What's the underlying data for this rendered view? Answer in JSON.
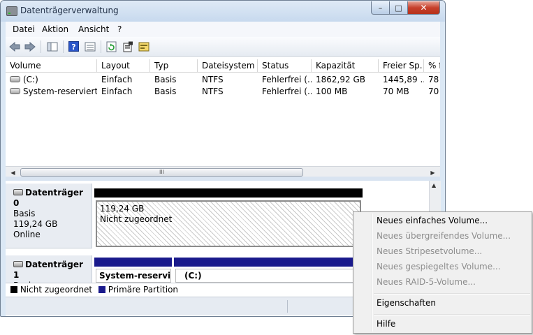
{
  "window": {
    "title": "Datenträgerverwaltung",
    "close_glyph": "✕",
    "min_glyph": "–",
    "max_glyph": "□"
  },
  "menu": [
    "Datei",
    "Aktion",
    "Ansicht",
    "?"
  ],
  "toolbar_icons": [
    "back-arrow-icon",
    "forward-arrow-icon",
    "console-tree-icon",
    "help-icon",
    "list-view-icon",
    "refresh-icon",
    "properties-icon",
    "rescan-icon"
  ],
  "columns": [
    "Volume",
    "Layout",
    "Typ",
    "Dateisystem",
    "Status",
    "Kapazität",
    "Freier Sp...",
    "% f"
  ],
  "volumes": [
    [
      "(C:)",
      "Einfach",
      "Basis",
      "NTFS",
      "Fehlerfrei (...",
      "1862,92 GB",
      "1445,89 ...",
      "78"
    ],
    [
      "System-reserviert",
      "Einfach",
      "Basis",
      "NTFS",
      "Fehlerfrei (...",
      "100 MB",
      "70 MB",
      "70"
    ]
  ],
  "scroll_grip": "III",
  "disks": [
    {
      "name": "Datenträger 0",
      "type": "Basis",
      "size": "119,24 GB",
      "state": "Online",
      "partition": {
        "size": "119,24 GB",
        "status": "Nicht zugeordnet"
      }
    },
    {
      "name": "Datenträger 1",
      "type": "Basis",
      "partitions": [
        {
          "label": "System-reserviert"
        },
        {
          "label": "(C:)"
        }
      ]
    }
  ],
  "legend": [
    {
      "label": "Nicht zugeordnet",
      "color": "#000000"
    },
    {
      "label": "Primäre Partition",
      "color": "#1a1a8c"
    }
  ],
  "context_menu": [
    {
      "label": "Neues einfaches Volume...",
      "enabled": true
    },
    {
      "label": "Neues übergreifendes Volume...",
      "enabled": false
    },
    {
      "label": "Neues Stripesetvolume...",
      "enabled": false
    },
    {
      "label": "Neues gespiegeltes Volume...",
      "enabled": false
    },
    {
      "label": "Neues RAID-5-Volume...",
      "enabled": false
    },
    {
      "label": "Eigenschaften",
      "enabled": true
    },
    {
      "label": "Hilfe",
      "enabled": true
    }
  ]
}
